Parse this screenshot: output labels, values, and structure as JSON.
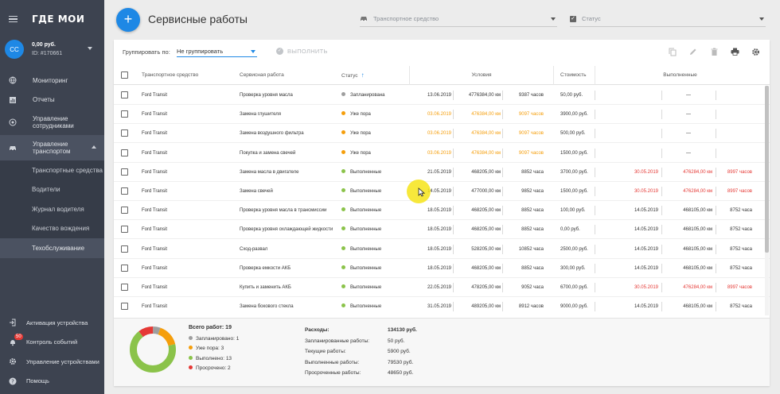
{
  "app": {
    "logo": "ГДЕ МОИ"
  },
  "account": {
    "initials": "CC",
    "balance": "0,00 руб.",
    "id": "ID: #170661"
  },
  "nav": {
    "items": [
      {
        "label": "Мониторинг"
      },
      {
        "label": "Отчеты"
      },
      {
        "label": "Управление сотрудниками"
      },
      {
        "label": "Управление транспортом"
      }
    ],
    "sub": [
      {
        "label": "Транспортные средства"
      },
      {
        "label": "Водители"
      },
      {
        "label": "Журнал водителя"
      },
      {
        "label": "Качество вождения"
      },
      {
        "label": "Техобслуживание"
      }
    ],
    "bottom": [
      {
        "label": "Активация устройства"
      },
      {
        "label": "Контроль событий",
        "badge": "50"
      },
      {
        "label": "Управление устройствами"
      },
      {
        "label": "Помощь"
      }
    ]
  },
  "header": {
    "add_label": "+",
    "title": "Сервисные работы",
    "vehicle_placeholder": "Транспортное средство",
    "status_placeholder": "Статус"
  },
  "toolbar": {
    "group_label": "Группировать по:",
    "group_value": "Не группировать",
    "execute_label": "ВЫПОЛНИТЬ"
  },
  "table": {
    "headers": {
      "vehicle": "Транспортное средство",
      "work": "Сервисная работа",
      "status": "Статус",
      "conditions": "Условия",
      "cost": "Стоимость",
      "done": "Выполненные"
    },
    "rows": [
      {
        "vehicle": "Ford Transit",
        "work": "Проверка уровня масла",
        "status": "Запланирована",
        "status_color": "#9e9e9e",
        "c_date": "13.06.2019",
        "c_km": "4776384,00 км",
        "c_hours": "9387 часов",
        "c_color": "normal",
        "cost": "50,00 руб.",
        "d_date": "",
        "d_km": "—",
        "d_hours": "",
        "d_color": "normal"
      },
      {
        "vehicle": "Ford Transit",
        "work": "Замена глушителя",
        "status": "Уже пора",
        "status_color": "#f59e0b",
        "c_date": "03.06.2019",
        "c_km": "476384,00 км",
        "c_hours": "9097 часов",
        "c_color": "orange",
        "cost": "3900,00 руб.",
        "d_date": "",
        "d_km": "—",
        "d_hours": "",
        "d_color": "normal"
      },
      {
        "vehicle": "Ford Transit",
        "work": "Замена воздушного фильтра",
        "status": "Уже пора",
        "status_color": "#f59e0b",
        "c_date": "03.06.2019",
        "c_km": "476384,00 км",
        "c_hours": "9097 часов",
        "c_color": "orange",
        "cost": "500,00 руб.",
        "d_date": "",
        "d_km": "—",
        "d_hours": "",
        "d_color": "normal"
      },
      {
        "vehicle": "Ford Transit",
        "work": "Покупка и замена свечей",
        "status": "Уже пора",
        "status_color": "#f59e0b",
        "c_date": "03.06.2019",
        "c_km": "476384,00 км",
        "c_hours": "9097 часов",
        "c_color": "orange",
        "cost": "1500,00 руб.",
        "d_date": "",
        "d_km": "—",
        "d_hours": "",
        "d_color": "normal"
      },
      {
        "vehicle": "Ford Transit",
        "work": "Замена масла в двигателе",
        "status": "Выполненные",
        "status_color": "#8bc34a",
        "c_date": "21.05.2019",
        "c_km": "468205,00 км",
        "c_hours": "8852 часа",
        "c_color": "normal",
        "cost": "3700,00 руб.",
        "d_date": "30.05.2019",
        "d_km": "476284,00 км",
        "d_hours": "8997 часов",
        "d_color": "red"
      },
      {
        "vehicle": "Ford Transit",
        "work": "Замена свечей",
        "status": "Выполненные",
        "status_color": "#8bc34a",
        "c_date": "14.05.2019",
        "c_km": "477000,00 км",
        "c_hours": "9852 часа",
        "c_color": "normal",
        "cost": "1500,00 руб.",
        "d_date": "30.05.2019",
        "d_km": "476284,00 км",
        "d_hours": "8997 часов",
        "d_color": "red"
      },
      {
        "vehicle": "Ford Transit",
        "work": "Проверка уровня масла в трансмиссии",
        "status": "Выполненные",
        "status_color": "#8bc34a",
        "c_date": "18.05.2019",
        "c_km": "468205,00 км",
        "c_hours": "8852 часа",
        "c_color": "normal",
        "cost": "100,00 руб.",
        "d_date": "14.05.2019",
        "d_km": "468105,00 км",
        "d_hours": "8752 часа",
        "d_color": "normal"
      },
      {
        "vehicle": "Ford Transit",
        "work": "Проверка уровня охлаждающей жидкости",
        "status": "Выполненные",
        "status_color": "#8bc34a",
        "c_date": "18.05.2019",
        "c_km": "468205,00 км",
        "c_hours": "8852 часа",
        "c_color": "normal",
        "cost": "0,00 руб.",
        "d_date": "14.05.2019",
        "d_km": "468105,00 км",
        "d_hours": "8752 часа",
        "d_color": "normal"
      },
      {
        "vehicle": "Ford Transit",
        "work": "Сход-развал",
        "status": "Выполненные",
        "status_color": "#8bc34a",
        "c_date": "18.05.2019",
        "c_km": "528205,00 км",
        "c_hours": "10852 часа",
        "c_color": "normal",
        "cost": "2500,00 руб.",
        "d_date": "14.05.2019",
        "d_km": "468105,00 км",
        "d_hours": "8752 часа",
        "d_color": "normal"
      },
      {
        "vehicle": "Ford Transit",
        "work": "Проверка емкости АКБ",
        "status": "Выполненные",
        "status_color": "#8bc34a",
        "c_date": "18.05.2019",
        "c_km": "468205,00 км",
        "c_hours": "8852 часа",
        "c_color": "normal",
        "cost": "300,00 руб.",
        "d_date": "14.05.2019",
        "d_km": "468105,00 км",
        "d_hours": "8752 часа",
        "d_color": "normal"
      },
      {
        "vehicle": "Ford Transit",
        "work": "Купить и заменить АКБ",
        "status": "Выполненные",
        "status_color": "#8bc34a",
        "c_date": "22.05.2019",
        "c_km": "478205,00 км",
        "c_hours": "9052 часа",
        "c_color": "normal",
        "cost": "6700,00 руб.",
        "d_date": "30.05.2019",
        "d_km": "476284,00 км",
        "d_hours": "8997 часов",
        "d_color": "red"
      },
      {
        "vehicle": "Ford Transit",
        "work": "Замена бокового стекла",
        "status": "Выполненные",
        "status_color": "#8bc34a",
        "c_date": "31.05.2019",
        "c_km": "489205,00 км",
        "c_hours": "8912 часов",
        "c_color": "normal",
        "cost": "9000,00 руб.",
        "d_date": "14.05.2019",
        "d_km": "468105,00 км",
        "d_hours": "8752 часа",
        "d_color": "normal"
      }
    ]
  },
  "summary": {
    "total": "Всего работ: 19",
    "legend": [
      {
        "label": "Запланировано: 1",
        "value": 1,
        "color": "#9e9e9e"
      },
      {
        "label": "Уже пора: 3",
        "value": 3,
        "color": "#f59e0b"
      },
      {
        "label": "Выполнено: 13",
        "value": 13,
        "color": "#8bc34a"
      },
      {
        "label": "Просрочено: 2",
        "value": 2,
        "color": "#e53935"
      }
    ],
    "expenses": [
      {
        "label": "Расходы:",
        "value": "134130 руб."
      },
      {
        "label": "Запланированные работы:",
        "value": "50 руб."
      },
      {
        "label": "Текущие работы:",
        "value": "5900 руб."
      },
      {
        "label": "Выполненные работы:",
        "value": "79530 руб."
      },
      {
        "label": "Просроченные работы:",
        "value": "48650 руб."
      }
    ]
  }
}
